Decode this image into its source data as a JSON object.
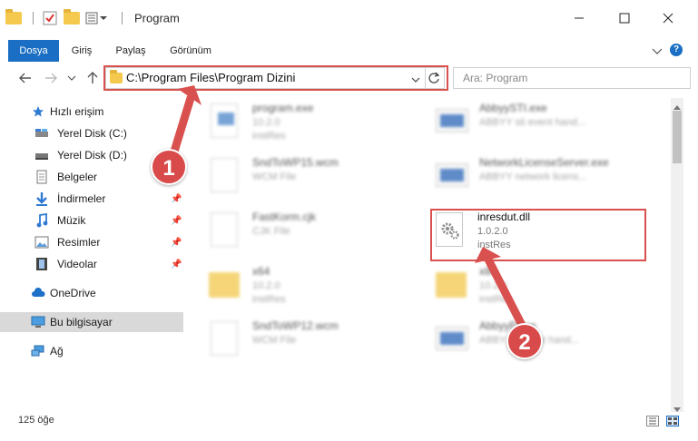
{
  "window": {
    "title": "Program"
  },
  "ribbon": {
    "tabs": [
      "Dosya",
      "Giriş",
      "Paylaş",
      "Görünüm"
    ],
    "accent_color": "#1a6fc4"
  },
  "address": {
    "path": "C:\\Program Files\\Program Dizini"
  },
  "search": {
    "placeholder": "Ara: Program"
  },
  "sidebar": {
    "items": [
      {
        "label": "Hızlı erişim",
        "icon": "star-icon"
      },
      {
        "label": "Yerel Disk (C:)",
        "icon": "drive-icon"
      },
      {
        "label": "Yerel Disk (D:)",
        "icon": "drive-icon"
      },
      {
        "label": "Belgeler",
        "icon": "document-icon"
      },
      {
        "label": "İndirmeler",
        "icon": "download-icon"
      },
      {
        "label": "Müzik",
        "icon": "music-icon"
      },
      {
        "label": "Resimler",
        "icon": "pictures-icon"
      },
      {
        "label": "Videolar",
        "icon": "video-icon"
      },
      {
        "label": "OneDrive",
        "icon": "cloud-icon"
      },
      {
        "label": "Bu bilgisayar",
        "icon": "computer-icon"
      },
      {
        "label": "Ağ",
        "icon": "network-icon"
      }
    ]
  },
  "files": {
    "left": [
      {
        "name": "program.exe",
        "line2": "10.2.0",
        "line3": "instRes"
      },
      {
        "name": "SndToWP15.wcm",
        "line2": "WCM File",
        "line3": ""
      },
      {
        "name": "FastKorm.cjk",
        "line2": "CJK File",
        "line3": ""
      },
      {
        "name": "x64",
        "line2": "10.2.0",
        "line3": "instRes"
      },
      {
        "name": "SndToWP12.wcm",
        "line2": "WCM File",
        "line3": ""
      }
    ],
    "right": [
      {
        "name": "AbbyySTI.exe",
        "line2": "ABBYY sti event hand...",
        "line3": ""
      },
      {
        "name": "NetworkLicenseServer.exe",
        "line2": "ABBYY network licens...",
        "line3": ""
      },
      {
        "name": "inresdut.dll",
        "line2": "1.0.2.0",
        "line3": "instRes"
      },
      {
        "name": "x86",
        "line2": "10.2.0",
        "line3": "instRes"
      },
      {
        "name": "AbbyyP.exe",
        "line2": "ABBY sti event hand...",
        "line3": ""
      }
    ]
  },
  "annotations": {
    "step1": "1",
    "step2": "2",
    "color": "#d9514f"
  },
  "status": {
    "count": "125 öğe"
  }
}
